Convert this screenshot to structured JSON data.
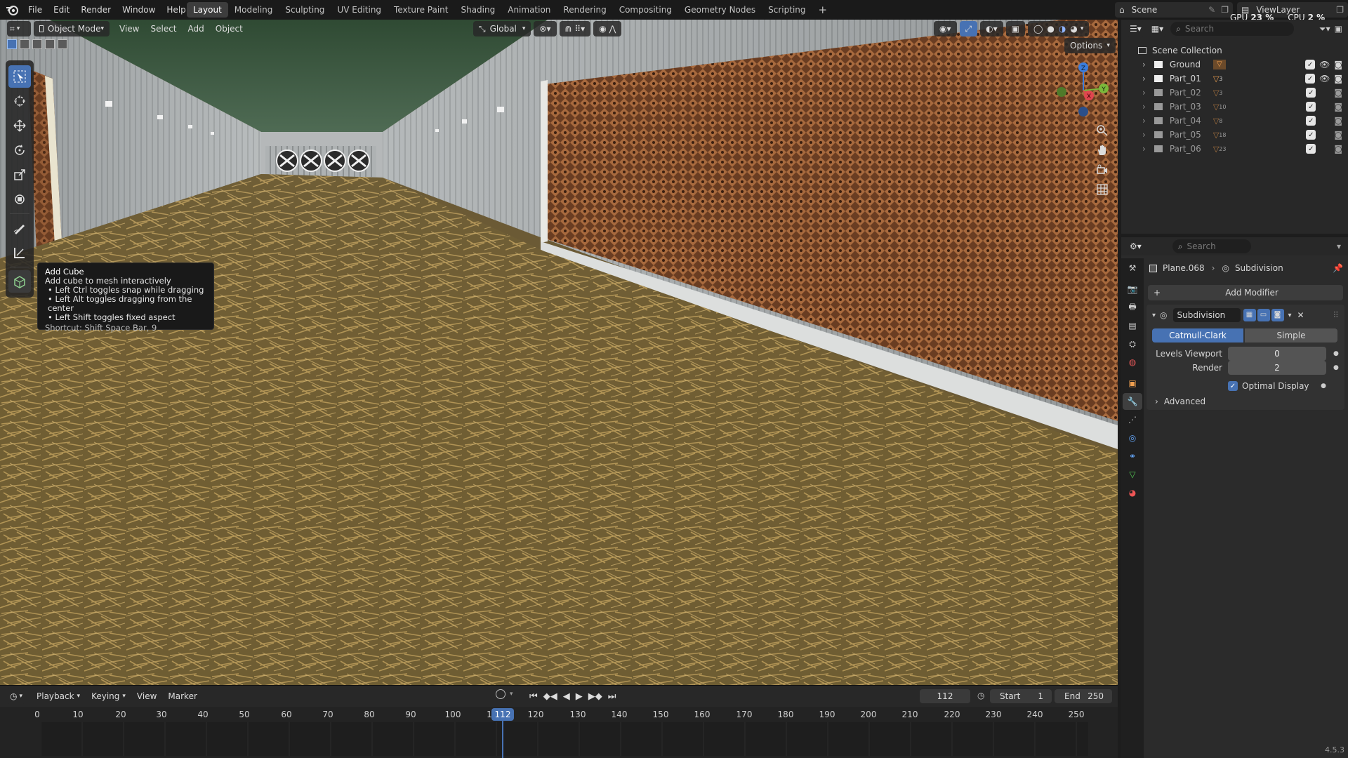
{
  "topbar": {
    "menus": [
      "File",
      "Edit",
      "Render",
      "Window",
      "Help"
    ],
    "workspaces": [
      "Layout",
      "Modeling",
      "Sculpting",
      "UV Editing",
      "Texture Paint",
      "Shading",
      "Animation",
      "Rendering",
      "Compositing",
      "Geometry Nodes",
      "Scripting"
    ],
    "active_workspace": "Layout",
    "scene_label": "Scene",
    "viewlayer_label": "ViewLayer",
    "gpu_label": "GPU",
    "gpu_value": "23 %",
    "cpu_label": "CPU",
    "cpu_value": "2 %"
  },
  "viewport_header": {
    "mode": "Object Mode",
    "menus": [
      "View",
      "Select",
      "Add",
      "Object"
    ],
    "orientation": "Global",
    "options_label": "Options"
  },
  "tooltip": {
    "title": "Add Cube",
    "description": "Add cube to mesh interactively",
    "bullets": [
      "• Left Ctrl toggles snap while dragging",
      "• Left Alt toggles dragging from the center",
      "• Left Shift toggles fixed aspect"
    ],
    "shortcut": "Shortcut: Shift Space Bar, 9"
  },
  "toolbar": {
    "tools": [
      "select-box",
      "cursor",
      "move",
      "rotate",
      "scale",
      "transform",
      "annotate",
      "measure",
      "add-cube"
    ],
    "active_tool": "select-box"
  },
  "outliner": {
    "search_placeholder": "Search",
    "root": "Scene Collection",
    "items": [
      {
        "name": "Ground",
        "count": "",
        "dim": false,
        "eye": true
      },
      {
        "name": "Part_01",
        "count": "3",
        "dim": false,
        "eye": true
      },
      {
        "name": "Part_02",
        "count": "3",
        "dim": true,
        "eye": false
      },
      {
        "name": "Part_03",
        "count": "10",
        "dim": true,
        "eye": false
      },
      {
        "name": "Part_04",
        "count": "8",
        "dim": true,
        "eye": false
      },
      {
        "name": "Part_05",
        "count": "18",
        "dim": true,
        "eye": false
      },
      {
        "name": "Part_06",
        "count": "23",
        "dim": true,
        "eye": false
      }
    ]
  },
  "properties": {
    "search_placeholder": "Search",
    "object_name": "Plane.068",
    "modifier_crumb": "Subdivision",
    "add_modifier_label": "Add Modifier",
    "modifier": {
      "name": "Subdivision",
      "type_options": [
        "Catmull-Clark",
        "Simple"
      ],
      "selected_type": "Catmull-Clark",
      "levels_viewport_label": "Levels Viewport",
      "levels_viewport_value": "0",
      "render_label": "Render",
      "render_value": "2",
      "optimal_display_label": "Optimal Display",
      "advanced_label": "Advanced"
    }
  },
  "timeline": {
    "menus": [
      "Playback",
      "Keying",
      "View",
      "Marker"
    ],
    "current_frame": "112",
    "start_label": "Start",
    "start_value": "1",
    "end_label": "End",
    "end_value": "250",
    "ruler_ticks": [
      "0",
      "10",
      "20",
      "30",
      "40",
      "50",
      "60",
      "70",
      "80",
      "90",
      "100",
      "1",
      "112",
      "120",
      "130",
      "140",
      "150",
      "160",
      "170",
      "180",
      "190",
      "200",
      "210",
      "220",
      "230",
      "240",
      "250"
    ]
  },
  "statusbar": {
    "version": "4.5.3"
  },
  "colors": {
    "accent": "#4772b3",
    "panel": "#282828",
    "header": "#1a1a1a"
  }
}
